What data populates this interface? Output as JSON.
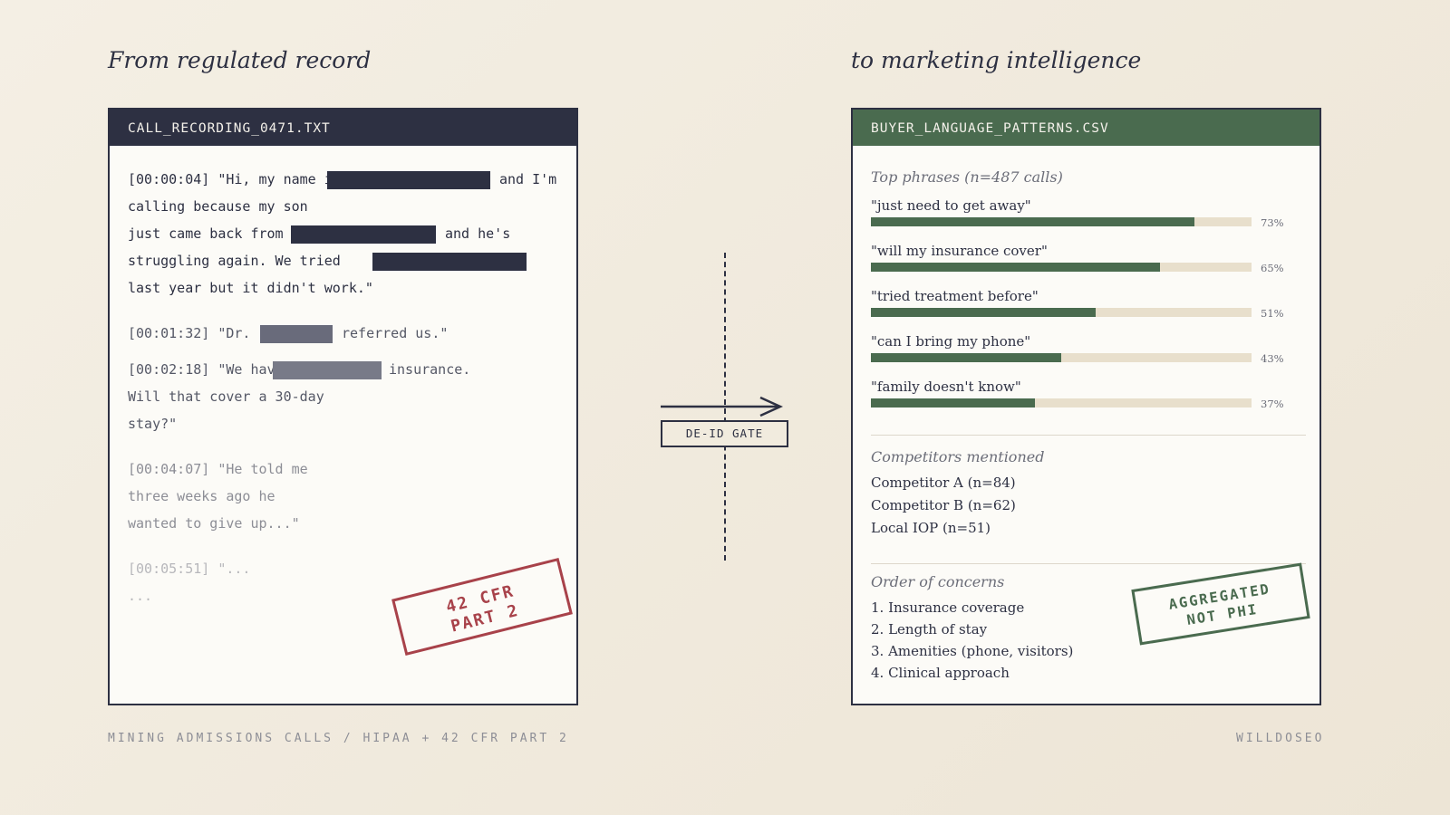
{
  "left_heading": "From regulated record",
  "right_heading": "to marketing intelligence",
  "left_panel": {
    "filename": "CALL_RECORDING_0471.TXT",
    "lines": {
      "l1_a": "[00:00:04] \"Hi, my name i",
      "l1_b": "and I'm",
      "l2": "calling because my son",
      "l3_a": "just came back from",
      "l3_b": "and he's",
      "l4": "struggling again. We tried",
      "l5": "last year but it didn't work.\"",
      "l6_a": "[00:01:32] \"Dr.",
      "l6_b": "referred us.\"",
      "l7_a": "[00:02:18] \"We have",
      "l7_b": "insurance.",
      "l8": "Will that cover a 30-day",
      "l9": "stay?\"",
      "l10": "[00:04:07] \"He told me",
      "l11": "three weeks ago he",
      "l12": "wanted to give up...\"",
      "l13": "[00:05:51] \"...",
      "l14": "..."
    },
    "stamp_line1": "42 CFR",
    "stamp_line2": "PART 2"
  },
  "gate": {
    "label": "DE-ID GATE"
  },
  "right_panel": {
    "filename": "BUYER_LANGUAGE_PATTERNS.CSV",
    "phrases_title": "Top phrases (n=487 calls)",
    "phrases": [
      {
        "label": "\"just need to get away\"",
        "pct_text": "73%",
        "value": 0.85
      },
      {
        "label": "\"will my insurance cover\"",
        "pct_text": "65%",
        "value": 0.76
      },
      {
        "label": "\"tried treatment before\"",
        "pct_text": "51%",
        "value": 0.59
      },
      {
        "label": "\"can I bring my phone\"",
        "pct_text": "43%",
        "value": 0.5
      },
      {
        "label": "\"family doesn't know\"",
        "pct_text": "37%",
        "value": 0.43
      }
    ],
    "competitors_title": "Competitors mentioned",
    "competitors": [
      "Competitor A (n=84)",
      "Competitor B (n=62)",
      "Local IOP (n=51)"
    ],
    "concerns_title": "Order of concerns",
    "concerns": [
      "1. Insurance coverage",
      "2. Length of stay",
      "3. Amenities (phone, visitors)",
      "4. Clinical approach"
    ],
    "stamp_line1": "AGGREGATED",
    "stamp_line2": "NOT PHI"
  },
  "footer": {
    "left": "MINING ADMISSIONS CALLS / HIPAA + 42 CFR PART 2",
    "right": "WILLDOSEO"
  },
  "colors": {
    "navy": "#2d3042",
    "green": "#4a6b4f",
    "stamp_red": "#a8424a",
    "bar_track": "#e8dfcc"
  }
}
